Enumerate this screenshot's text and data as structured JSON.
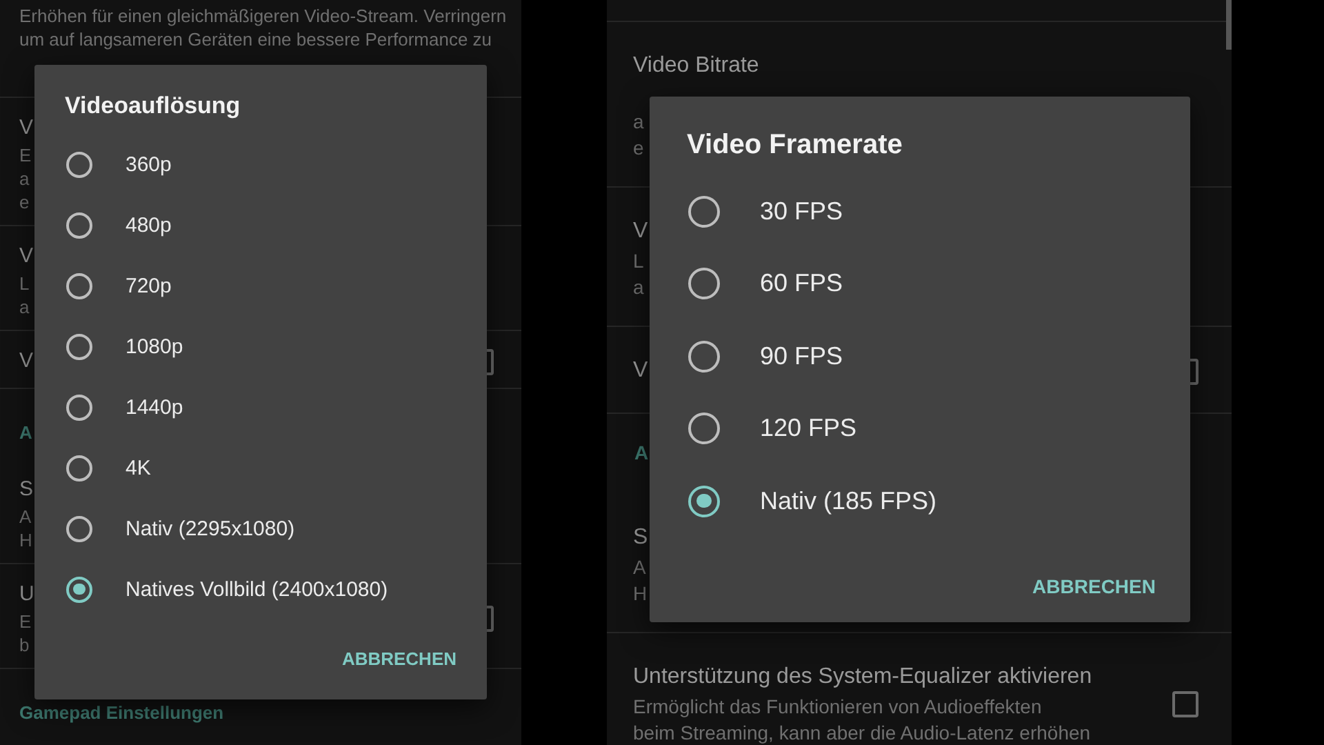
{
  "screens": [
    {
      "background": [
        {
          "kind": "setting",
          "lines": [
            "Erhöhen für einen gleichmäßigeren Video-Stream. Verringern",
            "um auf langsameren Geräten eine bessere Performance zu"
          ]
        },
        {
          "kind": "setting",
          "title": "V",
          "lines": [
            "E",
            "a",
            "e"
          ]
        },
        {
          "kind": "setting",
          "title": "V",
          "lines": [
            "L",
            "a"
          ]
        },
        {
          "kind": "setting",
          "title": "V",
          "checkbox": {
            "checked": false
          }
        },
        {
          "kind": "section",
          "title": "A"
        },
        {
          "kind": "setting",
          "title": "S",
          "lines": [
            "A",
            "H"
          ]
        },
        {
          "kind": "setting",
          "title": "U",
          "lines": [
            "E",
            "b"
          ],
          "checkbox": {
            "checked": false
          }
        },
        {
          "kind": "section",
          "title": "Gamepad Einstellungen"
        }
      ],
      "dialog": {
        "title": "Videoauflösung",
        "options": [
          {
            "label": "360p",
            "selected": false
          },
          {
            "label": "480p",
            "selected": false
          },
          {
            "label": "720p",
            "selected": false
          },
          {
            "label": "1080p",
            "selected": false
          },
          {
            "label": "1440p",
            "selected": false
          },
          {
            "label": "4K",
            "selected": false
          },
          {
            "label": "Nativ (2295x1080)",
            "selected": false
          },
          {
            "label": "Natives Vollbild (2400x1080)",
            "selected": true
          }
        ],
        "cancel": "ABBRECHEN"
      }
    },
    {
      "background": [
        {
          "kind": "setting",
          "title": "Video Bitrate",
          "lines": [
            "a",
            "e"
          ]
        },
        {
          "kind": "setting",
          "title": "V",
          "lines": [
            "L",
            "a"
          ]
        },
        {
          "kind": "setting",
          "title": "V",
          "checkbox": {
            "checked": false
          }
        },
        {
          "kind": "section",
          "title": "A"
        },
        {
          "kind": "setting",
          "title": "S",
          "lines": [
            "A",
            "H"
          ]
        },
        {
          "kind": "setting",
          "title": "Unterstützung des System-Equalizer aktivieren",
          "lines": [
            "Ermöglicht das Funktionieren von Audioeffekten",
            "beim Streaming, kann aber die Audio-Latenz erhöhen"
          ],
          "checkbox": {
            "checked": false
          }
        }
      ],
      "dialog": {
        "title": "Video Framerate",
        "options": [
          {
            "label": "30 FPS",
            "selected": false
          },
          {
            "label": "60 FPS",
            "selected": false
          },
          {
            "label": "90 FPS",
            "selected": false
          },
          {
            "label": "120 FPS",
            "selected": false
          },
          {
            "label": "Nativ (185 FPS)",
            "selected": true
          }
        ],
        "cancel": "ABBRECHEN"
      }
    }
  ]
}
